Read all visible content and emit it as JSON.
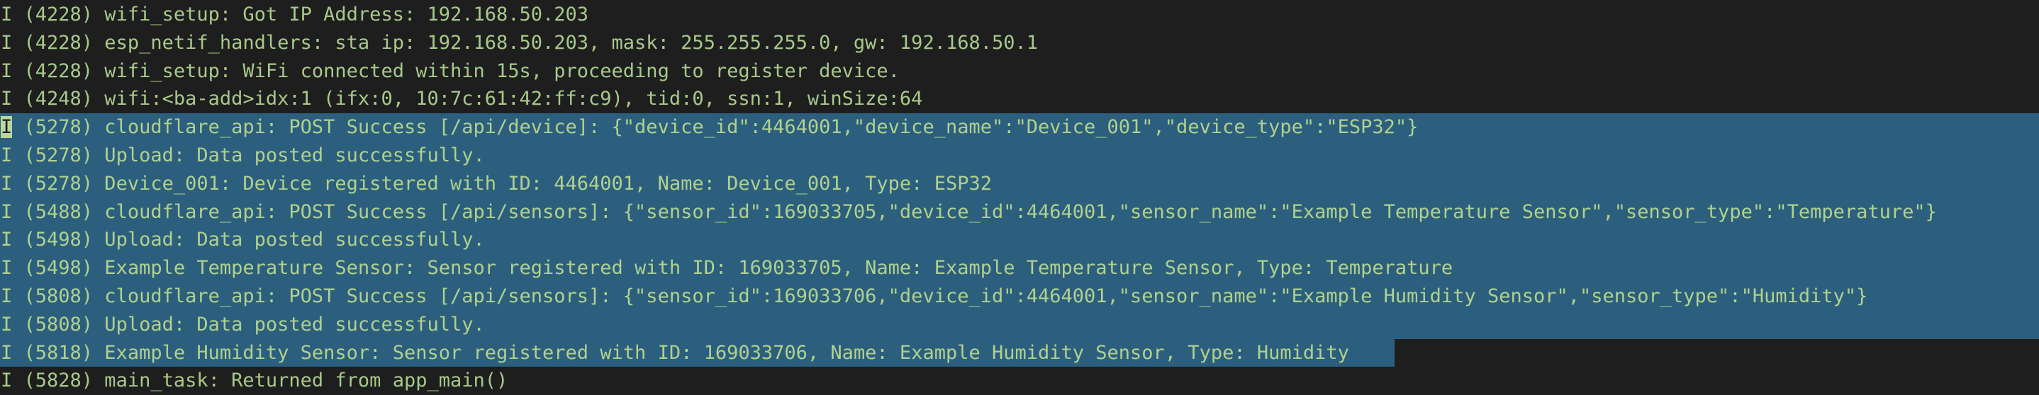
{
  "terminal": {
    "lines": [
      {
        "level": "I",
        "text": " (4228) wifi_setup: Got IP Address: 192.168.50.203"
      },
      {
        "level": "I",
        "text": " (4228) esp_netif_handlers: sta ip: 192.168.50.203, mask: 255.255.255.0, gw: 192.168.50.1"
      },
      {
        "level": "I",
        "text": " (4228) wifi_setup: WiFi connected within 15s, proceeding to register device."
      },
      {
        "level": "I",
        "text": " (4248) wifi:<ba-add>idx:1 (ifx:0, 10:7c:61:42:ff:c9), tid:0, ssn:1, winSize:64"
      },
      {
        "level": "I",
        "text": " (5278) cloudflare_api: POST Success [/api/device]: {\"device_id\":4464001,\"device_name\":\"Device_001\",\"device_type\":\"ESP32\"}"
      },
      {
        "level": "I",
        "text": " (5278) Upload: Data posted successfully."
      },
      {
        "level": "I",
        "text": " (5278) Device_001: Device registered with ID: 4464001, Name: Device_001, Type: ESP32"
      },
      {
        "level": "I",
        "text": " (5488) cloudflare_api: POST Success [/api/sensors]: {\"sensor_id\":169033705,\"device_id\":4464001,\"sensor_name\":\"Example Temperature Sensor\",\"sensor_type\":\"Temperature\"}"
      },
      {
        "level": "I",
        "text": " (5498) Upload: Data posted successfully."
      },
      {
        "level": "I",
        "text": " (5498) Example Temperature Sensor: Sensor registered with ID: 169033705, Name: Example Temperature Sensor, Type: Temperature"
      },
      {
        "level": "I",
        "text": " (5808) cloudflare_api: POST Success [/api/sensors]: {\"sensor_id\":169033706,\"device_id\":4464001,\"sensor_name\":\"Example Humidity Sensor\",\"sensor_type\":\"Humidity\"}"
      },
      {
        "level": "I",
        "text": " (5808) Upload: Data posted successfully."
      },
      {
        "level": "I",
        "text": " (5818) Example Humidity Sensor: Sensor registered with ID: 169033706, Name: Example Humidity Sensor, Type: Humidity"
      },
      {
        "level": "I",
        "text": " (5828) main_task: Returned from app_main()"
      }
    ]
  },
  "colors": {
    "background": "#1e1e1e",
    "text": "#a7c98a",
    "selection": "#2c5f7e"
  }
}
